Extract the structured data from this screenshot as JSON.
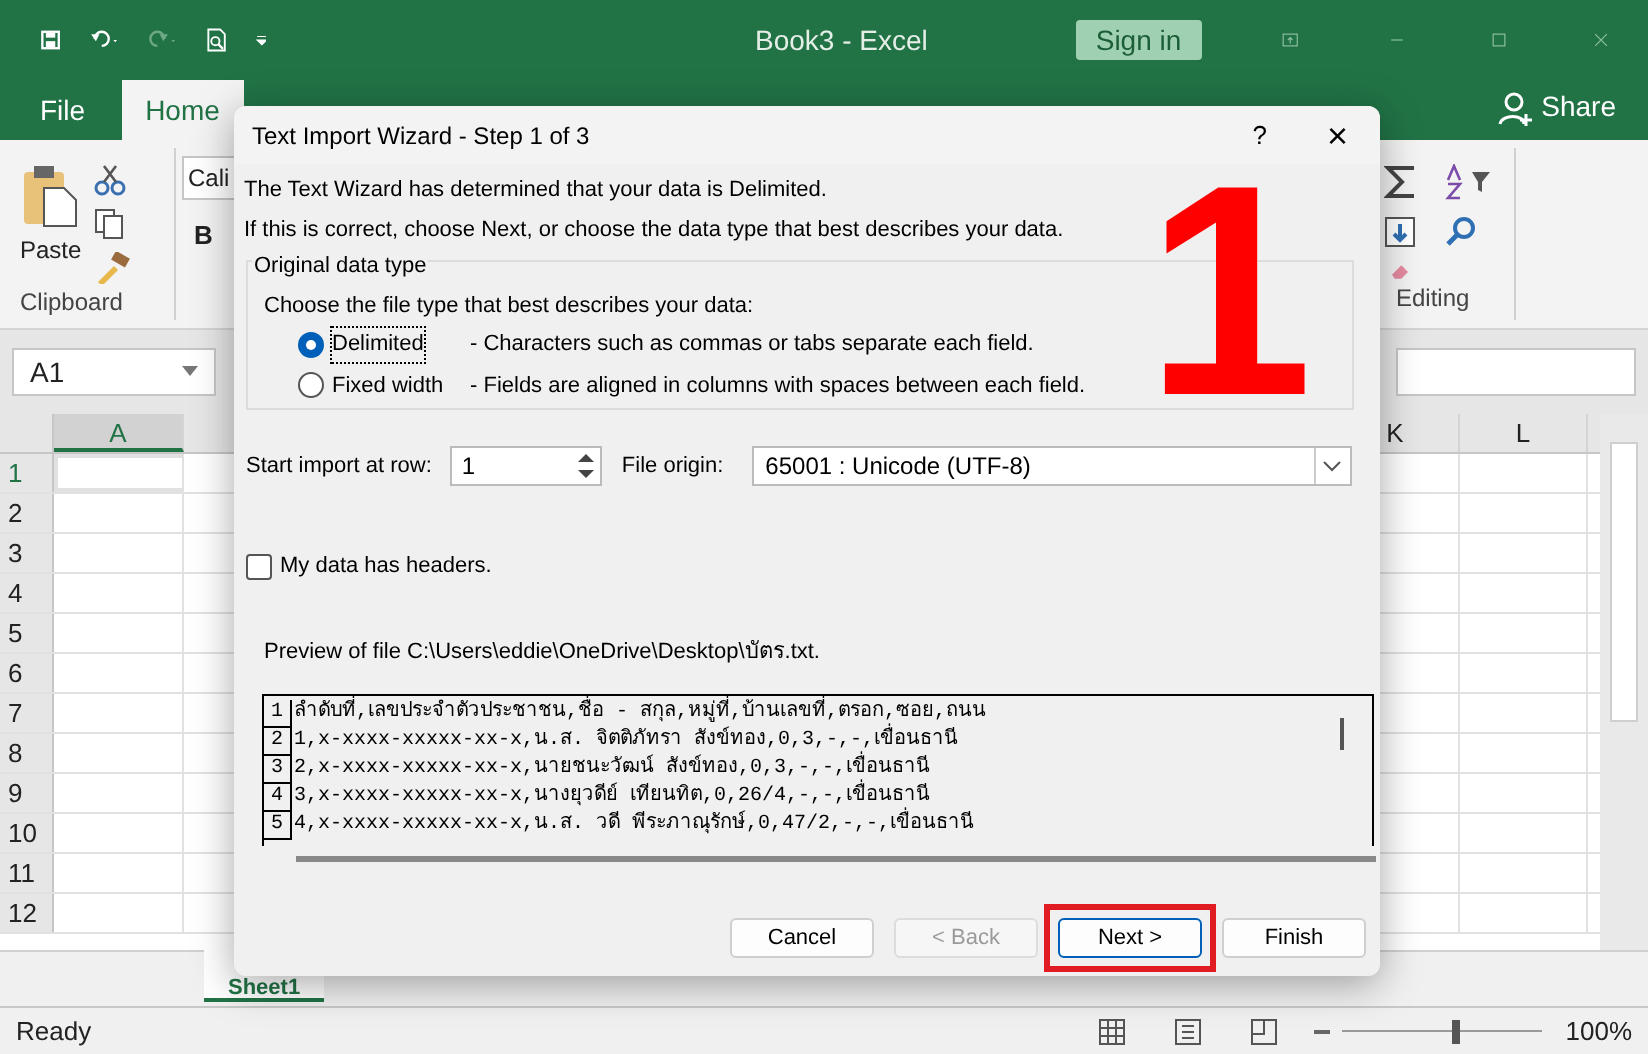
{
  "title_bar": {
    "title": "Book3  -  Excel",
    "sign_in": "Sign in"
  },
  "ribbon": {
    "tabs": [
      {
        "label": "File",
        "selected": false
      },
      {
        "label": "Home",
        "selected": true
      }
    ],
    "share": "Share",
    "font_box": "Cali",
    "bold": "B",
    "paste": "Paste",
    "groups": [
      "Clipboard",
      "Editing"
    ]
  },
  "name_box": "A1",
  "columns": [
    "A",
    "K",
    "L"
  ],
  "rows": [
    "1",
    "2",
    "3",
    "4",
    "5",
    "6",
    "7",
    "8",
    "9",
    "10",
    "11",
    "12"
  ],
  "sheet_tab": "Sheet1",
  "status_bar": {
    "status": "Ready",
    "zoom": "100%",
    "level": 0.55
  },
  "dialog": {
    "title": "Text Import Wizard - Step 1 of 3",
    "help": "?",
    "close": "×",
    "message": "The Text Wizard has determined that your data is Delimited.",
    "hint": "If this is correct, choose Next, or choose the data type that best describes your data.",
    "group_title": "Original data type",
    "prompt": "Choose the file type that best describes your data:",
    "options": [
      {
        "label": "Delimited",
        "description": "- Characters such as commas or tabs separate each field.",
        "selected": true
      },
      {
        "label": "Fixed width",
        "description": "- Fields are aligned in columns with spaces between each field.",
        "selected": false
      }
    ],
    "start_row_label": "Start import at row:",
    "start_row": "1",
    "file_origin_label": "File origin:",
    "file_origin": "65001 : Unicode (UTF-8)",
    "headers_checkbox": {
      "label": "My data has headers.",
      "checked": false
    },
    "preview_label": "Preview of file C:\\Users\\eddie\\OneDrive\\Desktop\\บัตร.txt.",
    "preview_lines": [
      {
        "number": "1",
        "text": "ลำดับที่,เลขประจำตัวประชาชน,ชื่อ - สกุล,หมู่ที่,บ้านเลขที่,ตรอก,ซอย,ถนน"
      },
      {
        "number": "2",
        "text": "1,x-xxxx-xxxxx-xx-x,น.ส. จิตติภัทรา สังข์ทอง,0,3,-,-,เขื่อนธานี"
      },
      {
        "number": "3",
        "text": "2,x-xxxx-xxxxx-xx-x,นายชนะวัฒน์ สังข์ทอง,0,3,-,-,เขื่อนธานี"
      },
      {
        "number": "4",
        "text": "3,x-xxxx-xxxxx-xx-x,นางยุวดีย์ เทียนทิต,0,26/4,-,-,เขื่อนธานี"
      },
      {
        "number": "5",
        "text": "4,x-xxxx-xxxxx-xx-x,น.ส. วดี พีระภาณุรักษ์,0,47/2,-,-,เขื่อนธานี"
      }
    ],
    "buttons": [
      {
        "label": "Cancel",
        "disabled": false,
        "highlighted": false
      },
      {
        "label": "< Back",
        "disabled": true,
        "highlighted": false
      },
      {
        "label": "Next >",
        "disabled": false,
        "highlighted": true
      },
      {
        "label": "Finish",
        "disabled": false,
        "highlighted": false
      }
    ]
  },
  "annotation": "1"
}
